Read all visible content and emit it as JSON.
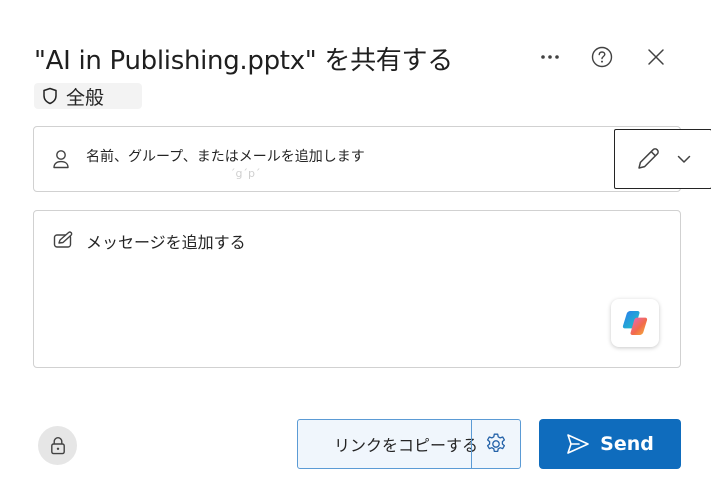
{
  "dialog": {
    "title": "\"AI in Publishing.pptx\" を共有する",
    "header_icons": [
      "more-icon",
      "help-icon",
      "close-icon"
    ],
    "sensitivity_label": "全般"
  },
  "people_picker": {
    "placeholder": "名前、グループ、またはメールを追加します",
    "ghost_text": "ˊgˊpˊ",
    "permission_icon": "pencil-icon"
  },
  "message": {
    "placeholder": "メッセージを追加する"
  },
  "footer": {
    "copy_link_label": "リンクをコピーする",
    "send_label": "Send"
  },
  "colors": {
    "primary": "#0f6cbd",
    "copy_border": "#5b9bd5",
    "copy_bg": "#f0f6fc",
    "border": "#d1d1d1"
  }
}
